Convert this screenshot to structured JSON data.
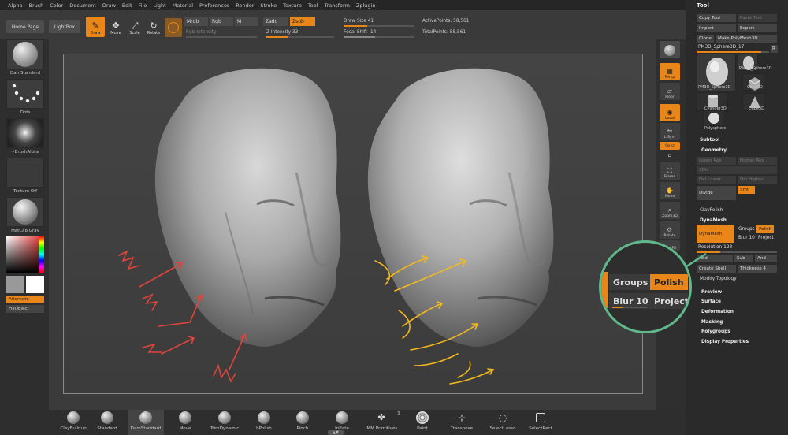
{
  "menubar": {
    "items": [
      "Alpha",
      "Brush",
      "Color",
      "Document",
      "Draw",
      "Edit",
      "File",
      "Light",
      "Material",
      "Preferences",
      "Render",
      "Stroke",
      "Texture",
      "Tool",
      "Transform",
      "Zplugin"
    ],
    "panel_title": "Tool"
  },
  "toolbar": {
    "home": "Home Page",
    "lightbox": "LightBox",
    "draw": "Draw",
    "move": "Move",
    "scale": "Scale",
    "rotate": "Rotate",
    "mrgb": "Mrgb",
    "rgb": "Rgb",
    "m": "M",
    "zadd": "Zadd",
    "zsub": "Zsub",
    "rgb_intensity": "Rgb Intensity",
    "z_intensity": "Z Intensity 33",
    "draw_size": "Draw Size 41",
    "focal_shift": "Focal Shift -14",
    "active_points": "ActivePoints: 58,561",
    "total_points": "TotalPoints: 58,561",
    "z_intensity_value": 33,
    "draw_size_value": 41
  },
  "left": {
    "brush": "DamStandard",
    "stroke": "Dots",
    "alpha": "~BrushAlpha",
    "texture": "Texture Off",
    "material": "MatCap Gray",
    "alternate": "Alternate",
    "fillobject": "FillObject"
  },
  "right": {
    "bpr": "BPR",
    "persp": "Persp",
    "floor": "Floor",
    "local": "Local",
    "lsym": "L.Sym",
    "qxyz": "Qxyz",
    "frame": "Frame",
    "move": "Move",
    "zoom3d": "Zoom3D",
    "rotate": "Rotate",
    "linefill": "Line Fill",
    "polyf": "PolyF"
  },
  "toolpanel": {
    "copy_tool": "Copy Tool",
    "paste_tool": "Paste Tool",
    "import": "Import",
    "export": "Export",
    "clone": "Clone",
    "make_polymesh": "Make PolyMesh3D",
    "current_tool": "PM3D_Sphere3D_17",
    "r": "R",
    "thumbs": [
      "PM3D_Sphere3D",
      "PM3D_Sphere3D",
      "Cylinder3D",
      "Cube3D",
      "Cone3D",
      "Polysphere"
    ],
    "subtool": "Subtool",
    "geometry": "Geometry",
    "lower_res": "Lower Res",
    "higher_res": "Higher Res",
    "sdiv": "SDiv",
    "del_lower": "Del Lower",
    "del_higher": "Del Higher",
    "divide": "Divide",
    "smt": "Smt",
    "claypolish": "ClayPolish",
    "dynamesh_section": "DynaMesh",
    "dynamesh_btn": "DynaMesh",
    "groups": "Groups",
    "polish": "Polish",
    "blur": "Blur 10",
    "project": "Project",
    "resolution": "Resolution 128",
    "add": "Add",
    "sub": "Sub",
    "and": "And",
    "create_shell": "Create Shell",
    "thickness": "Thickness 4",
    "modify_topology": "Modify Topology",
    "sections": [
      "Preview",
      "Surface",
      "Deformation",
      "Masking",
      "Polygroups",
      "Display Properties"
    ]
  },
  "callout": {
    "groups": "Groups",
    "polish": "Polish",
    "blur": "Blur 10",
    "project": "Project",
    "blur_value": 10
  },
  "bottom": {
    "items": [
      "ClayBuildup",
      "Standard",
      "DamStandard",
      "Move",
      "TrimDynamic",
      "hPolish",
      "Pinch",
      "Inflate",
      "IMM Primitives",
      "Paint",
      "Transpose",
      "SelectLasso",
      "SelectRect"
    ],
    "imm_count": "3"
  },
  "colors": {
    "accent": "#e8861a",
    "callout_ring": "#5fb98a",
    "arrow_red": "#e0443a",
    "arrow_yellow": "#f2b81e"
  }
}
